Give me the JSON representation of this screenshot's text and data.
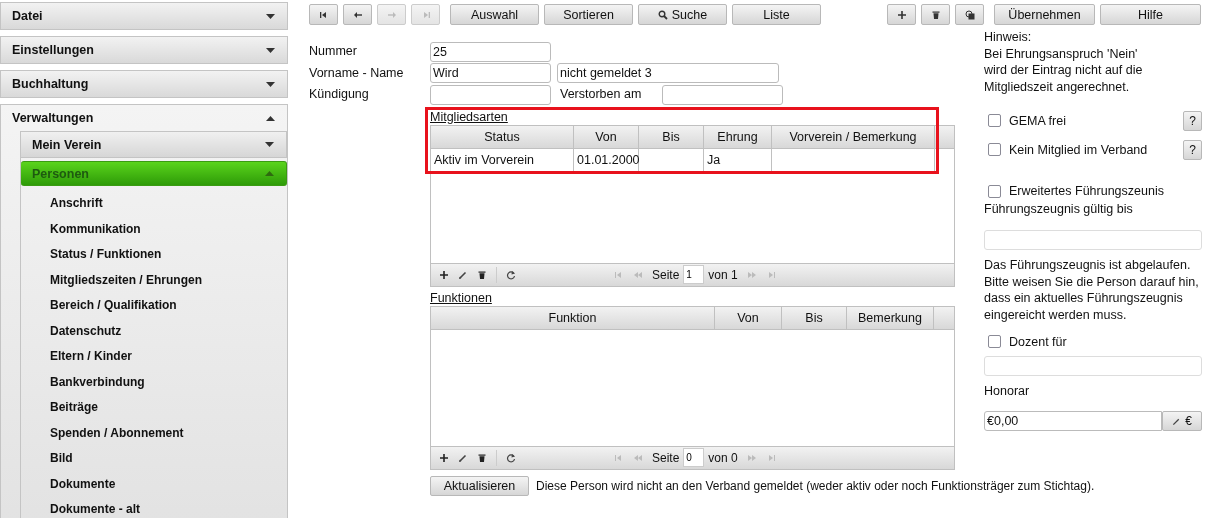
{
  "sidebar": [
    {
      "label": "Datei",
      "expanded": false
    },
    {
      "label": "Einstellungen",
      "expanded": false
    },
    {
      "label": "Buchhaltung",
      "expanded": false
    },
    {
      "label": "Verwaltungen",
      "expanded": true,
      "children": [
        {
          "label": "Mein Verein",
          "expanded": false,
          "selected": false
        },
        {
          "label": "Personen",
          "expanded": true,
          "selected": true,
          "children": [
            {
              "label": "Anschrift",
              "selected": false
            },
            {
              "label": "Kommunikation",
              "selected": false
            },
            {
              "label": "Status / Funktionen",
              "selected": false
            },
            {
              "label": "Mitgliedszeiten / Ehrungen",
              "selected": false
            },
            {
              "label": "Bereich / Qualifikation",
              "selected": false
            },
            {
              "label": "Datenschutz",
              "selected": false
            },
            {
              "label": "Eltern / Kinder",
              "selected": false
            },
            {
              "label": "Bankverbindung",
              "selected": false
            },
            {
              "label": "Beiträge",
              "selected": false
            },
            {
              "label": "Spenden / Abonnement",
              "selected": false
            },
            {
              "label": "Bild",
              "selected": false
            },
            {
              "label": "Dokumente",
              "selected": false
            },
            {
              "label": "Dokumente - alt",
              "selected": false
            }
          ]
        }
      ]
    }
  ],
  "toolbar": {
    "nav_buttons": [
      {
        "kind": "first",
        "disabled": false
      },
      {
        "kind": "prev",
        "disabled": false
      },
      {
        "kind": "next",
        "disabled": true
      },
      {
        "kind": "last",
        "disabled": true
      }
    ],
    "buttons": [
      {
        "label": "Auswahl"
      },
      {
        "label": "Sortieren"
      },
      {
        "label": "Suche",
        "kind": "search"
      },
      {
        "label": "Liste"
      }
    ],
    "icon_buttons": [
      {
        "kind": "add"
      },
      {
        "kind": "delete"
      },
      {
        "kind": "copy"
      }
    ],
    "action_buttons": [
      "Übernehmen",
      "Hilfe"
    ]
  },
  "form": {
    "nummer": {
      "label": "Nummer",
      "value": "25"
    },
    "name": {
      "label": "Vorname - Name",
      "first": "Wird",
      "last": "nicht gemeldet 3"
    },
    "kuendigung": {
      "label": "Kündigung"
    },
    "verstorben": {
      "label": "Verstorben am"
    }
  },
  "tables": [
    {
      "title": "Mitgliedsarten",
      "highlighted": true,
      "columns": [
        "Status",
        "Von",
        "Bis",
        "Ehrung",
        "Vorverein / Bemerkung"
      ],
      "rows": [
        [
          "Aktiv im Vorverein",
          "01.01.2000",
          "",
          "Ja",
          ""
        ]
      ],
      "page_label": "Seite",
      "page": "1",
      "of": "von 1"
    },
    {
      "title": "Funktionen",
      "columns": [
        "Funktion",
        "Von",
        "Bis",
        "Bemerkung"
      ],
      "page_label": "Seite",
      "page": "0",
      "of": "von 0"
    }
  ],
  "refresh_button": "Aktualisieren",
  "status_message": "Diese Person wird nicht an den Verband gemeldet (weder aktiv oder noch Funktionsträger zum Stichtag).",
  "right_panel": {
    "hint": "Hinweis:\nBei Ehrungsanspruch 'Nein'\nwird der Eintrag nicht auf die\nMitgliedszeit angerechnet.",
    "checks": [
      {
        "label": "GEMA frei",
        "checked": false,
        "help": "?"
      },
      {
        "label": "Kein Mitglied im Verband",
        "checked": false,
        "help": "?"
      }
    ],
    "extended": {
      "label": "Erweitertes Führungszeunis",
      "checked": false
    },
    "valid_label": "Führungszeugnis gültig bis",
    "warning": "Das Führungszeugnis ist abgelaufen.\nBitte weisen Sie die Person darauf hin,\ndass ein aktuelles Führungszeugnis\neingereicht werden muss.",
    "dozent": {
      "label": "Dozent für",
      "checked": false
    },
    "honorar_label": "Honorar",
    "honorar_value": "€0,00",
    "currency_button": "€"
  }
}
